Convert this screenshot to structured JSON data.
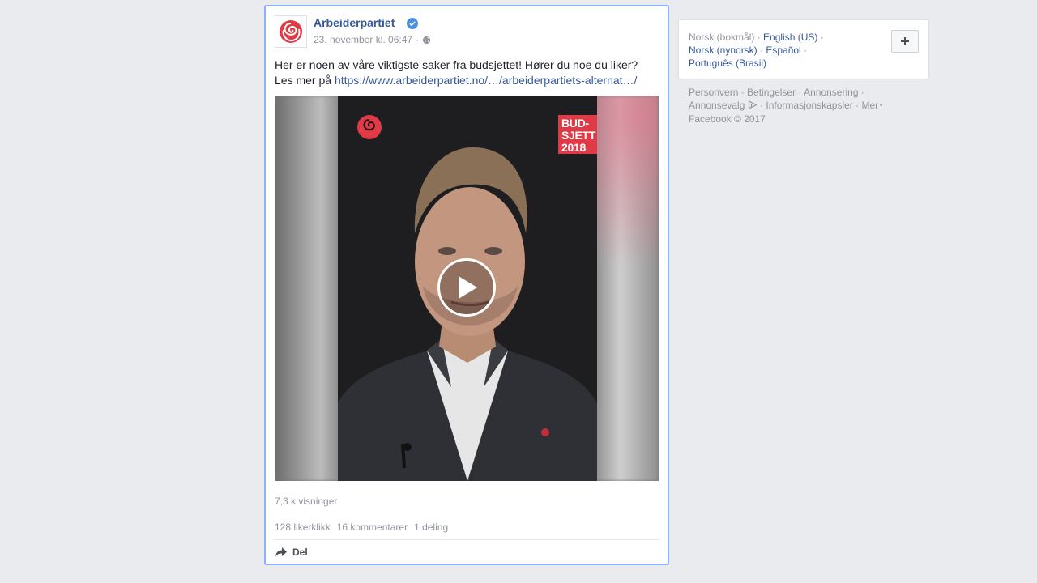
{
  "post": {
    "page_name": "Arbeiderpartiet",
    "timestamp": "23. november kl. 06:47",
    "text_line1": "Her er noen av våre viktigste saker fra budsjettet! Hører du noe du liker?",
    "text_prefix": "Les mer på ",
    "link": "https://www.arbeiderpartiet.no/…/arbeiderpartiets-alternat…/",
    "video": {
      "badge_line1": "BUD-",
      "badge_line2": "SJETT",
      "badge_line3": "2018"
    },
    "views": "7,3 k visninger",
    "likes": "128 likerklikk",
    "comments": "16 kommentarer",
    "shares": "1 deling",
    "share_label": "Del"
  },
  "languages": {
    "current": "Norsk (bokmål)",
    "items": [
      "English (US)",
      "Norsk (nynorsk)",
      "Español",
      "Português (Brasil)"
    ]
  },
  "footer": {
    "links": [
      "Personvern",
      "Betingelser",
      "Annonsering",
      "Annonsevalg",
      "Informasjonskapsler",
      "Mer"
    ],
    "copyright": "Facebook © 2017"
  },
  "colors": {
    "link": "#365899",
    "muted": "#90949c",
    "background": "#e9ebee",
    "brand_red": "#e03a47",
    "focus_border": "#8fb0ff"
  }
}
